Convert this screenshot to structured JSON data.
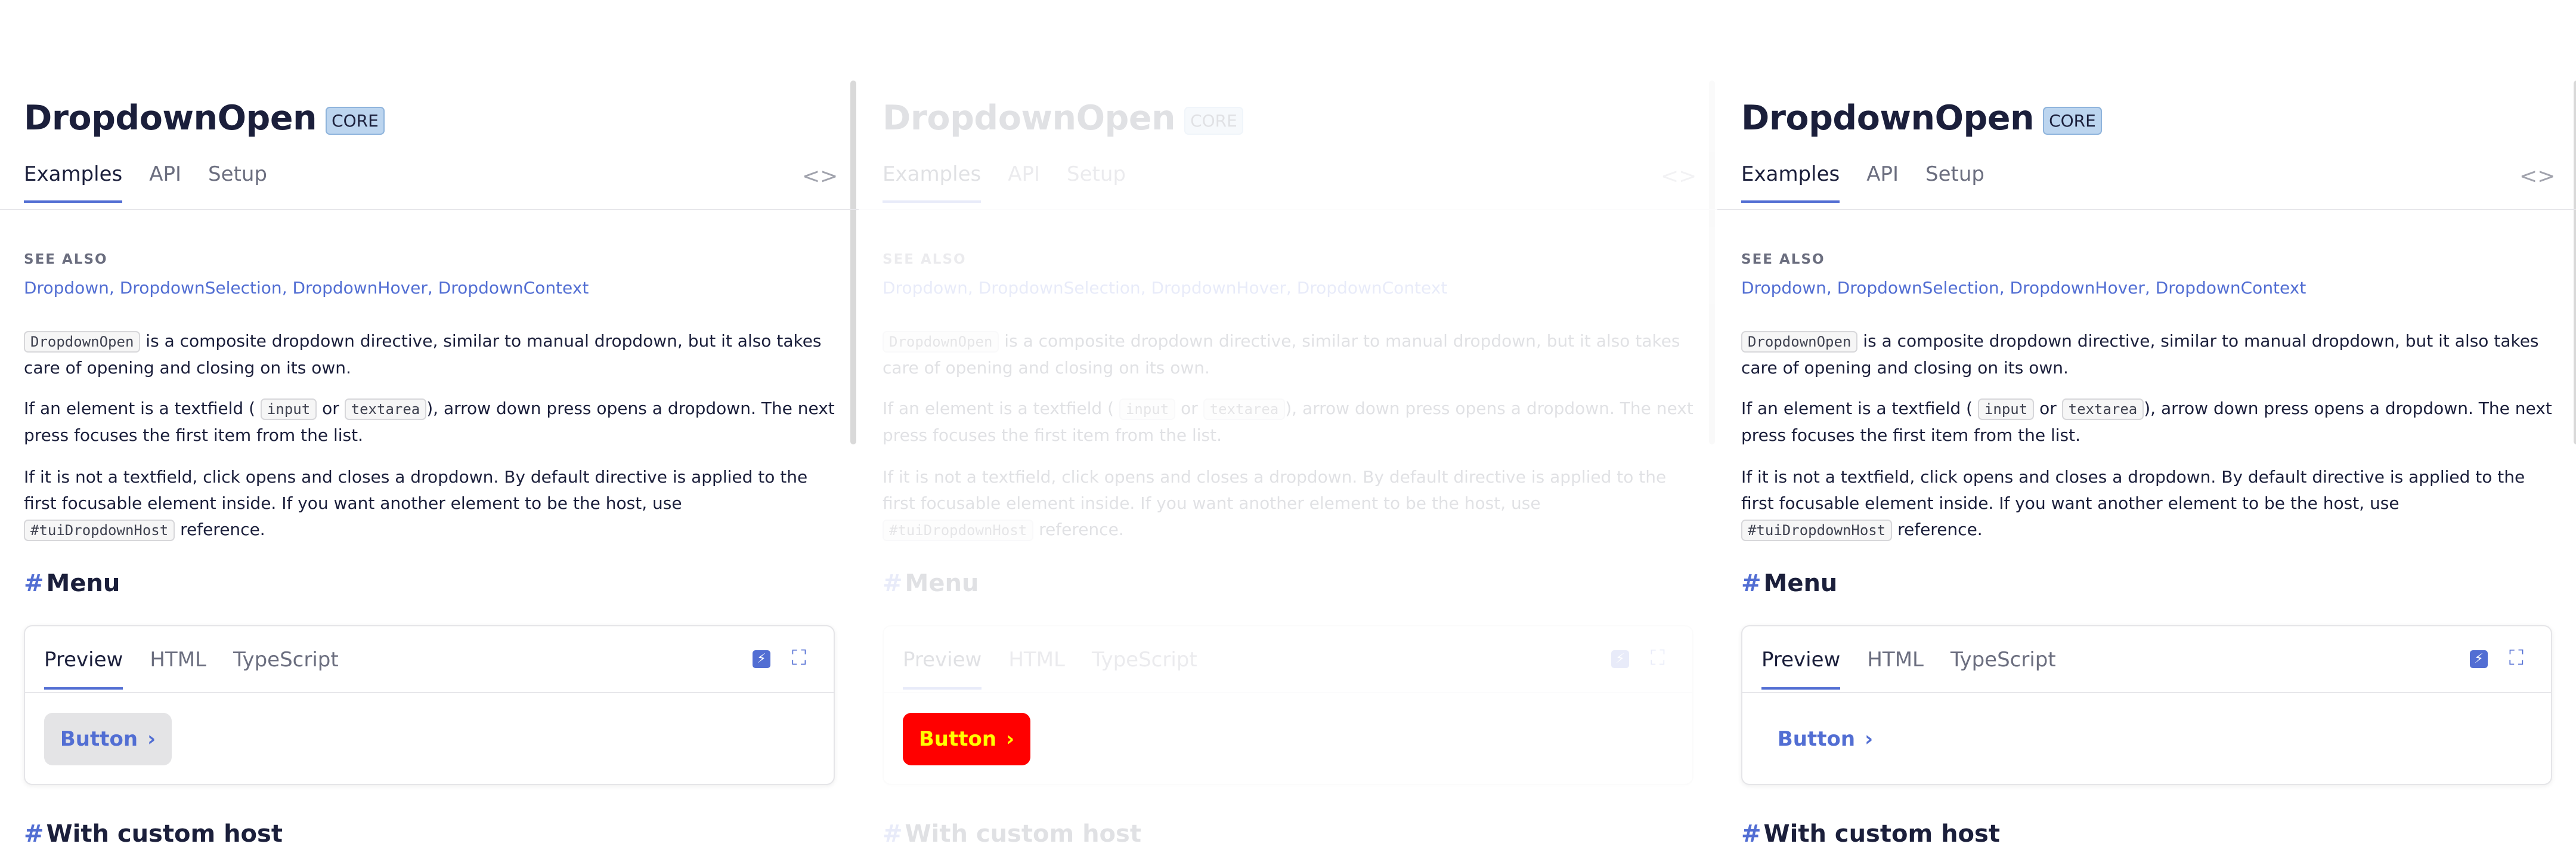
{
  "page": {
    "title": "DropdownOpen",
    "badge": "CORE",
    "tabs": [
      "Examples",
      "API",
      "Setup"
    ],
    "code_toggle": "<>",
    "see_also_heading": "SEE ALSO",
    "see_also_links": [
      "Dropdown",
      "DropdownSelection",
      "DropdownHover",
      "DropdownContext"
    ],
    "para1": {
      "code": "DropdownOpen",
      "text": "is a composite dropdown directive, similar to manual dropdown, but it also takes care of opening and closing on its own."
    },
    "para2": {
      "before": "If an element is a textfield (",
      "code1": "input",
      "mid": "or",
      "code2": "textarea",
      "after": "), arrow down press opens a dropdown. The next press focuses the first item from the list."
    },
    "para3": {
      "before": "If it is not a textfield, click opens and closes a dropdown. By default directive is applied to the first focusable element inside. If you want another element to be the host, use",
      "code": "#tuiDropdownHost",
      "after": "reference."
    },
    "section_menu": "Menu",
    "section_host": "With custom host",
    "hash": "#",
    "card_tabs": [
      "Preview",
      "HTML",
      "TypeScript"
    ],
    "button_label": "Button",
    "chevron": "›"
  },
  "variants": [
    {
      "state": "hover",
      "button_bg": "#e4e4e6",
      "button_fg": "#526ed3"
    },
    {
      "state": "faded",
      "button_bg": "#ff0000",
      "button_fg": "#ffff00"
    },
    {
      "state": "default",
      "button_bg": "transparent",
      "button_fg": "#526ed3"
    }
  ],
  "colors": {
    "accent": "#526ed3",
    "text": "#1b1f3b",
    "muted": "#6b6e7f",
    "badge_bg": "#bcd5ef"
  }
}
